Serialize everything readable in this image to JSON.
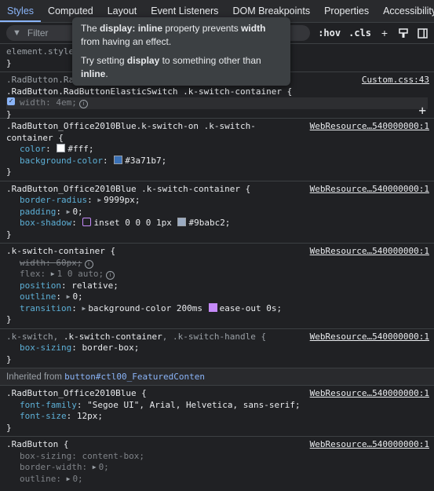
{
  "tabs": [
    "Styles",
    "Computed",
    "Layout",
    "Event Listeners",
    "DOM Breakpoints",
    "Properties",
    "Accessibility"
  ],
  "toolbar": {
    "filter_placeholder": "Filter",
    "hov": ":hov",
    "cls": ".cls"
  },
  "tooltip": {
    "line1_pre": "The ",
    "line1_bold1": "display: inline",
    "line1_mid": " property prevents ",
    "line1_bold2": "width",
    "line1_post": " from having an effect.",
    "line2_pre": "Try setting ",
    "line2_bold1": "display",
    "line2_mid": " to something other than ",
    "line2_bold2": "inline",
    "line2_post": "."
  },
  "element_style": {
    "selector": "element.style",
    "close": "}"
  },
  "rule1": {
    "sel1": ".RadButton.Ra",
    "sel2": ".RadButton.RadButtonElasticSwitch .k-switch-container {",
    "source": "Custom.css:43",
    "prop": "width",
    "val": "4em;"
  },
  "rule2": {
    "selector": ".RadButton_Office2010Blue.k-switch-on .k-switch-",
    "selector2": "container {",
    "source": "WebResource…540000000:1",
    "decls": [
      {
        "prop": "color",
        "val": "#fff;",
        "swatch": "#ffffff"
      },
      {
        "prop": "background-color",
        "val": "#3a71b7;",
        "swatch": "#3a71b7"
      }
    ]
  },
  "rule3": {
    "selector": ".RadButton_Office2010Blue .k-switch-container {",
    "source": "WebResource…540000000:1",
    "decls": [
      {
        "prop": "border-radius",
        "val": "9999px;"
      },
      {
        "prop": "padding",
        "val": "0;"
      },
      {
        "prop": "box-shadow",
        "val": "inset 0 0 0 1px",
        "val2": "#9babc2;",
        "swatch": "#9babc2"
      }
    ]
  },
  "rule4": {
    "selector": ".k-switch-container {",
    "source": "WebResource…540000000:1",
    "decls": [
      {
        "prop": "width",
        "val": "60px;"
      },
      {
        "prop": "flex",
        "val": "1 0 auto;"
      },
      {
        "prop": "position",
        "val": "relative;"
      },
      {
        "prop": "outline",
        "val": "0;"
      },
      {
        "prop": "transition",
        "val": "background-color 200ms",
        "val2": "ease-out 0s;"
      }
    ]
  },
  "rule5": {
    "sel_a": ".k-switch, ",
    "sel_b": ".k-switch-container",
    "sel_c": ", .k-switch-handle {",
    "source": "WebResource…540000000:1",
    "decls": [
      {
        "prop": "box-sizing",
        "val": "border-box;"
      }
    ]
  },
  "inherited": {
    "label": "Inherited from ",
    "element": "button#ctl00_FeaturedConten"
  },
  "rule6": {
    "selector": ".RadButton_Office2010Blue {",
    "source": "WebResource…540000000:1",
    "decls": [
      {
        "prop": "font-family",
        "val": "\"Segoe UI\", Arial, Helvetica, sans-serif;"
      },
      {
        "prop": "font-size",
        "val": "12px;"
      }
    ]
  },
  "rule7": {
    "selector": ".RadButton {",
    "source": "WebResource…540000000:1",
    "decls": [
      {
        "prop": "box-sizing",
        "val": "content-box;"
      },
      {
        "prop": "border-width",
        "val": "0;"
      },
      {
        "prop": "outline",
        "val": "0;"
      }
    ]
  },
  "close": "}",
  "colon": ": "
}
